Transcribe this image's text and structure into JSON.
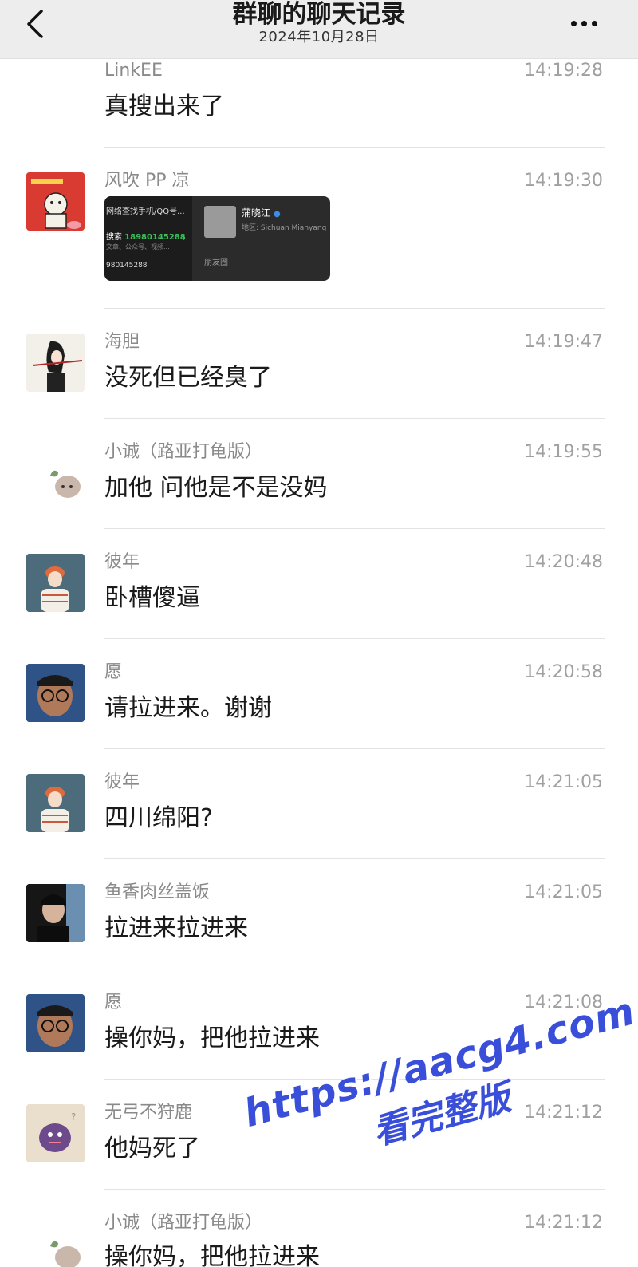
{
  "header": {
    "title": "群聊的聊天记录",
    "date": "2024年10月28日"
  },
  "messages": [
    {
      "name": "LinkEE",
      "time": "14:19:28",
      "text": "真搜出来了"
    },
    {
      "name": "风吹 PP 凉",
      "time": "14:19:30",
      "text": ""
    },
    {
      "name": "海胆",
      "time": "14:19:47",
      "text": "没死但已经臭了"
    },
    {
      "name": "小诚（路亚打龟版）",
      "time": "14:19:55",
      "text": "加他 问他是不是没妈"
    },
    {
      "name": "彼年",
      "time": "14:20:48",
      "text": "卧槽傻逼"
    },
    {
      "name": "愿",
      "time": "14:20:58",
      "text": "请拉进来。谢谢"
    },
    {
      "name": "彼年",
      "time": "14:21:05",
      "text": "四川绵阳?"
    },
    {
      "name": "鱼香肉丝盖饭",
      "time": "14:21:05",
      "text": "拉进来拉进来"
    },
    {
      "name": "愿",
      "time": "14:21:08",
      "text": "操你妈，把他拉进来"
    },
    {
      "name": "无弓不狩鹿",
      "time": "14:21:12",
      "text": "他妈死了"
    },
    {
      "name": "小诚（路亚打龟版）",
      "time": "14:21:12",
      "text": "操你妈，把他拉进来"
    }
  ],
  "card": {
    "left_title": "网络查找手机/QQ号...",
    "search_label": "搜索",
    "search_number": "18980145288",
    "left_sub": "文章、公众号、视频...",
    "left_bottom": "980145288",
    "profile_name": "蒲晓江",
    "profile_region": "地区: Sichuan Mianyang",
    "moments": "朋友圈"
  },
  "watermark": {
    "line1": "https://aacg4.com",
    "line2": "看完整版"
  },
  "colors": {
    "header_bg": "#ededed",
    "name": "#8a8a8a",
    "time": "#a0a0a0",
    "watermark": "#3a4fd9"
  }
}
